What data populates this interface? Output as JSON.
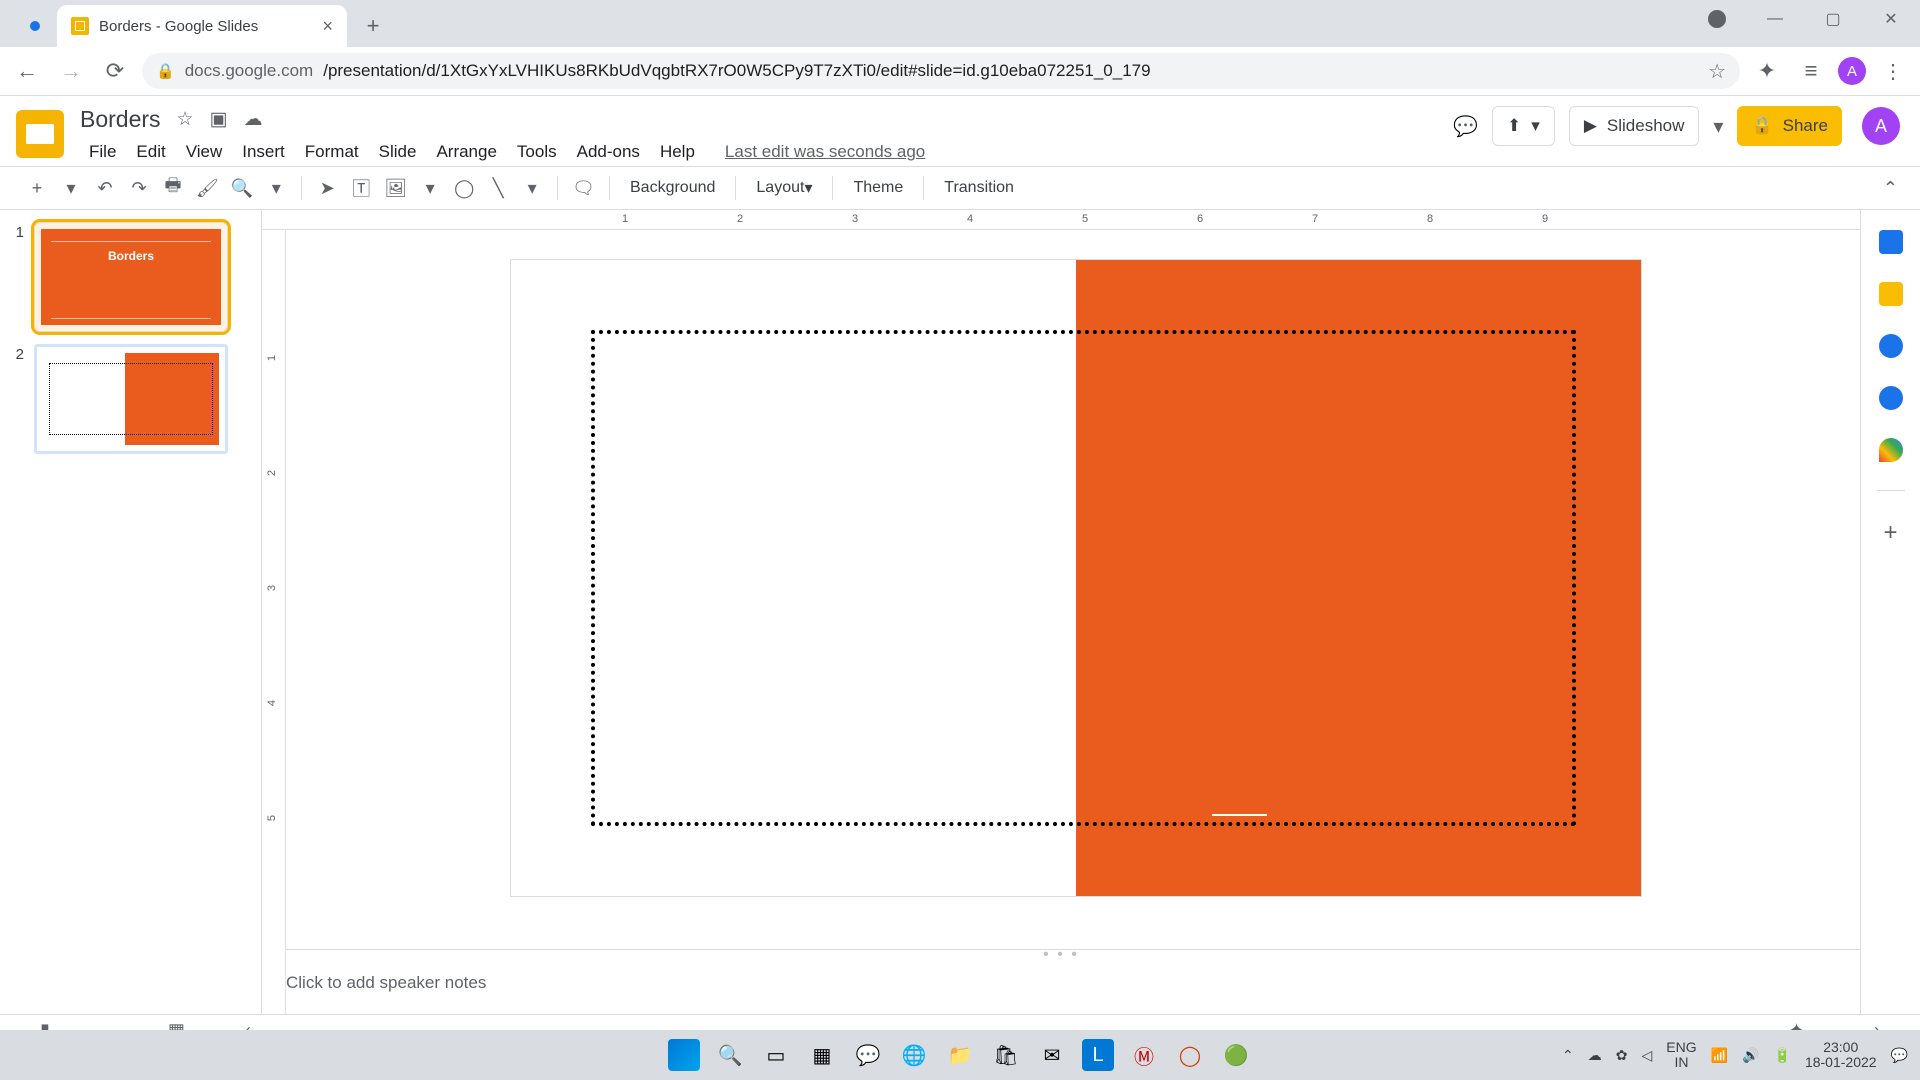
{
  "browser": {
    "tab_title": "Borders - Google Slides",
    "url_host": "docs.google.com",
    "url_path": "/presentation/d/1XtGxYxLVHIKUs8RKbUdVqgbtRX7rO0W5CPy9T7zXTi0/edit#slide=id.g10eba072251_0_179",
    "avatar_letter": "A"
  },
  "doc": {
    "title": "Borders",
    "last_edit": "Last edit was seconds ago"
  },
  "menus": [
    "File",
    "Edit",
    "View",
    "Insert",
    "Format",
    "Slide",
    "Arrange",
    "Tools",
    "Add-ons",
    "Help"
  ],
  "toolbar": {
    "background": "Background",
    "layout": "Layout",
    "theme": "Theme",
    "transition": "Transition"
  },
  "header_buttons": {
    "slideshow": "Slideshow",
    "share": "Share"
  },
  "ruler_h": [
    "1",
    "2",
    "3",
    "4",
    "5",
    "6",
    "7",
    "8",
    "9"
  ],
  "ruler_v": [
    "1",
    "2",
    "3",
    "4",
    "5"
  ],
  "thumbs": {
    "n1": "1",
    "t1_title": "Borders",
    "n2": "2"
  },
  "notes_placeholder": "Click to add speaker notes",
  "taskbar": {
    "lang1": "ENG",
    "lang2": "IN",
    "time": "23:00",
    "date": "18-01-2022"
  },
  "colors": {
    "orange": "#ea5b1e",
    "yellow": "#fbbc04",
    "purple": "#a142f4"
  }
}
